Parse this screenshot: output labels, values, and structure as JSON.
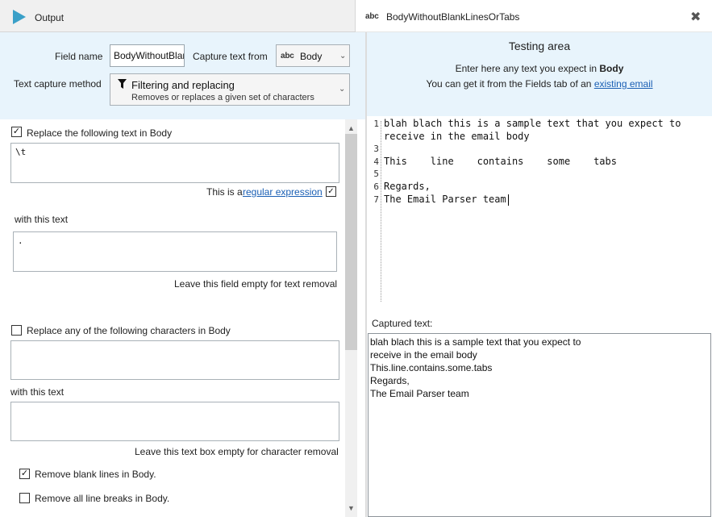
{
  "tabs": {
    "output_label": "Output",
    "field_icon": "abc",
    "field_label": "BodyWithoutBlankLinesOrTabs",
    "close": "✖"
  },
  "field_name": {
    "label": "Field name",
    "value": "BodyWithoutBlan"
  },
  "capture_from": {
    "label": "Capture text from",
    "icon": "abc",
    "value": "Body"
  },
  "capture_method": {
    "label": "Text capture method",
    "title": "Filtering and replacing",
    "subtitle": "Removes or replaces a given set of characters"
  },
  "replace_text": {
    "checkbox_label": "Replace the following text in Body",
    "checked": true,
    "find_value": "\\t",
    "regex_prefix": "This is a",
    "regex_link": "regular expression",
    "regex_checked": true,
    "with_label": "with this text",
    "replace_value": ".",
    "hint": "Leave this field empty for text removal"
  },
  "replace_chars": {
    "checkbox_label": "Replace any of the following characters in Body",
    "checked": false,
    "with_label": "with this text",
    "hint": "Leave this text box empty for character removal"
  },
  "options": {
    "remove_blank": {
      "label": "Remove blank lines in Body.",
      "checked": true
    },
    "remove_breaks": {
      "label": "Remove all line breaks in Body.",
      "checked": false
    }
  },
  "testing": {
    "title": "Testing area",
    "instruction_prefix": "Enter here any text you expect in",
    "instruction_field": "Body",
    "source_prefix": "You can get it from the Fields tab of an",
    "source_link": "existing email",
    "editor_lines": [
      {
        "num": "1",
        "text": "blah blach this is a sample text that you expect to"
      },
      {
        "num": "",
        "text": "receive in the email body"
      },
      {
        "num": "3",
        "text": ""
      },
      {
        "num": "4",
        "text": "This    line    contains    some    tabs"
      },
      {
        "num": "5",
        "text": ""
      },
      {
        "num": "6",
        "text": "Regards,"
      },
      {
        "num": "7",
        "text": "The Email Parser team"
      }
    ],
    "captured_label": "Captured text:",
    "captured_lines": [
      "blah blach this is a sample text that you expect to",
      "receive in the email body",
      "This.line.contains.some.tabs",
      "Regards,",
      "The Email Parser team"
    ]
  }
}
